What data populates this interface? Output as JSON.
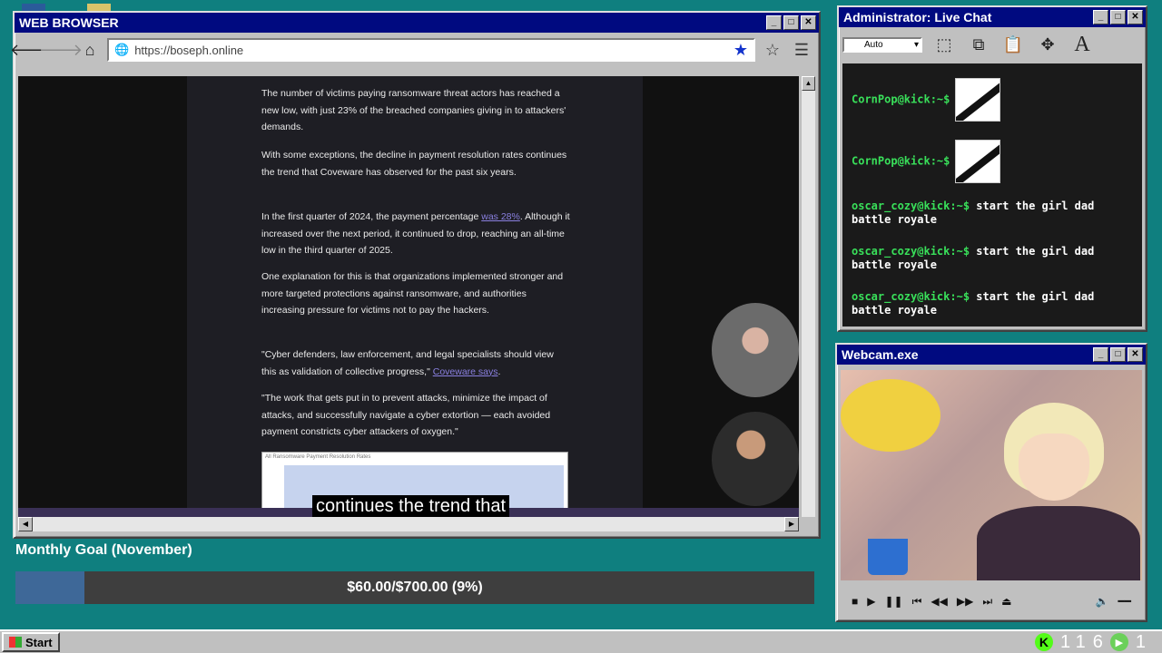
{
  "browser": {
    "title": "WEB BROWSER",
    "url": "https://boseph.online",
    "article": {
      "p1": "The number of victims paying ransomware threat actors has reached a new low, with just 23% of the breached companies giving in to attackers' demands.",
      "p2": "With some exceptions, the decline in payment resolution rates continues the trend that Coveware has observed for the past six years.",
      "p3_pre": "In the first quarter of 2024, the payment percentage ",
      "p3_link": "was 28%",
      "p3_post": ". Although it increased over the next period, it continued to drop, reaching an all-time low in the third quarter of 2025.",
      "p4": "One explanation for this is that organizations implemented stronger and more targeted protections against ransomware, and authorities increasing pressure for victims not to pay the hackers.",
      "p5_pre": "\"Cyber defenders, law enforcement, and legal specialists should view this as validation of collective progress,\" ",
      "p5_link": "Coveware says",
      "p5_post": ".",
      "p6": "\"The work that gets put in to prevent attacks, minimize the impact of attacks, and successfully navigate a cyber extortion — each avoided payment constricts cyber attackers of oxygen.\"",
      "chart_title": "All Ransomware Payment Resolution Rates"
    },
    "caption": "continues the trend that"
  },
  "goal": {
    "title": "Monthly Goal (November)",
    "text": "$60.00/$700.00 (9%)",
    "progress": 0.086
  },
  "chat": {
    "title": "Administrator: Live Chat",
    "select": "Auto",
    "messages": [
      {
        "user": "CornPop@kick:~$",
        "text": "",
        "emote": true
      },
      {
        "user": "CornPop@kick:~$",
        "text": "",
        "emote": true
      },
      {
        "user": "oscar_cozy@kick:~$",
        "text": " start the girl dad battle royale"
      },
      {
        "user": "oscar_cozy@kick:~$",
        "text": " start the girl dad battle royale"
      },
      {
        "user": "oscar_cozy@kick:~$",
        "text": " start the girl dad battle royale"
      }
    ]
  },
  "webcam": {
    "title": "Webcam.exe"
  },
  "taskbar": {
    "start": "Start",
    "kick_count": "1 1",
    "count2": "6",
    "count3": "1"
  },
  "colors": {
    "desktop": "#0f7f7f",
    "titlebar": "#000a80",
    "chat_user": "#39e05a",
    "goal_fill": "#3e6898"
  }
}
